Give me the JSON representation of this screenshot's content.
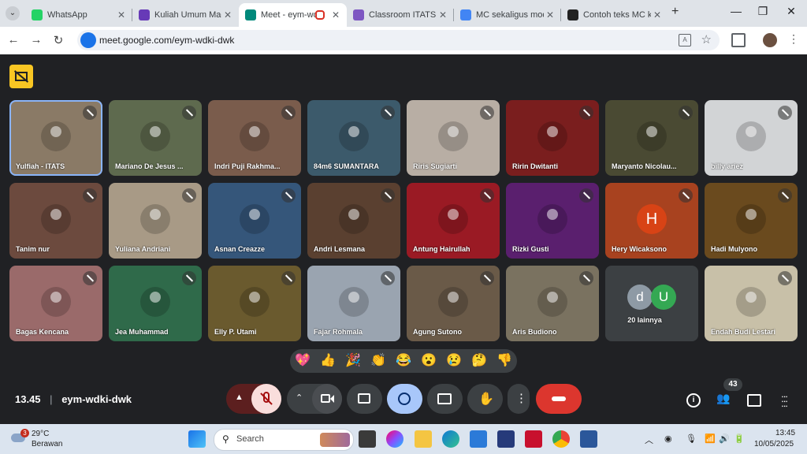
{
  "browser": {
    "tabs": [
      {
        "title": "WhatsApp",
        "color": "#25d366"
      },
      {
        "title": "Kuliah Umum Mag",
        "color": "#673ab7"
      },
      {
        "title": "Meet - eym-wd",
        "color": "#00897b"
      },
      {
        "title": "Classroom ITATS",
        "color": "#7e57c2"
      },
      {
        "title": "MC sekaligus mod",
        "color": "#4285f4"
      },
      {
        "title": "Contoh teks MC k",
        "color": "#222222"
      }
    ],
    "new_tab": "+",
    "address": "meet.google.com/eym-wdki-dwk"
  },
  "participants": [
    {
      "name": "Yulfiah - ITATS",
      "bg": "#8a7a66"
    },
    {
      "name": "Mariano De Jesus ...",
      "bg": "#5e6a4e"
    },
    {
      "name": "Indri Puji Rakhma...",
      "bg": "#7a5c4c"
    },
    {
      "name": "84m6 SUMANTARA",
      "bg": "#3c5a6b"
    },
    {
      "name": "Riris Sugiarti",
      "bg": "#b8aea4"
    },
    {
      "name": "Ririn Dwitanti",
      "bg": "#7a1e1e"
    },
    {
      "name": "Maryanto Nicolau...",
      "bg": "#4a4a33"
    },
    {
      "name": "billy ariez",
      "bg": "#d2d4d6"
    },
    {
      "name": "Tanim nur",
      "bg": "#6c4a3e"
    },
    {
      "name": "Yuliana Andriani",
      "bg": "#a89a86"
    },
    {
      "name": "Asnan Creazze",
      "bg": "#35567a"
    },
    {
      "name": "Andri Lesmana",
      "bg": "#5a4030"
    },
    {
      "name": "Antung Hairullah",
      "bg": "#9a1a24"
    },
    {
      "name": "Rizki Gusti",
      "bg": "#5a1f6e"
    },
    {
      "name": "Hery Wicaksono",
      "bg": "#a8421f",
      "initial": "H"
    },
    {
      "name": "Hadi Mulyono",
      "bg": "#6a4a1e"
    },
    {
      "name": "Bagas Kencana",
      "bg": "#9a6a6a"
    },
    {
      "name": "Jea Muhammad",
      "bg": "#2f6a4a"
    },
    {
      "name": "Elly P. Utami",
      "bg": "#6a5a2e"
    },
    {
      "name": "Fajar Rohmala",
      "bg": "#9aa4b0"
    },
    {
      "name": "Agung Sutono",
      "bg": "#6a5a48"
    },
    {
      "name": "Aris Budiono",
      "bg": "#7a7260"
    },
    {
      "name": "20 lainnya",
      "bg": "#3c4043",
      "avatars": [
        "d",
        "U"
      ]
    },
    {
      "name": "Endah Budi Lestari",
      "bg": "#c8c0a8"
    }
  ],
  "reactions": [
    "💖",
    "👍",
    "🎉",
    "👏",
    "😂",
    "😮",
    "😢",
    "🤔",
    "👎"
  ],
  "meeting": {
    "time": "13.45",
    "separator": "|",
    "code": "eym-wdki-dwk",
    "participant_count": "43"
  },
  "taskbar": {
    "weather_temp": "29°C",
    "weather_desc": "Berawan",
    "weather_badge": "3",
    "search_placeholder": "Search",
    "clock_time": "13:45",
    "clock_date": "10/05/2025"
  }
}
